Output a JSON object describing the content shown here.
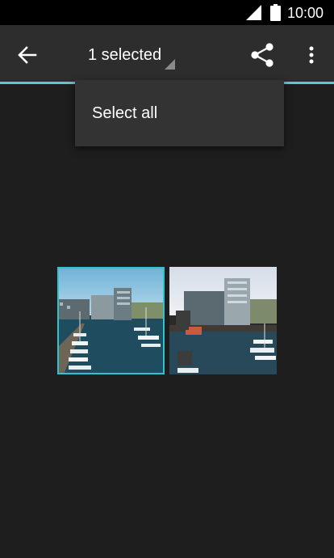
{
  "status_bar": {
    "time": "10:00",
    "signal_icon": "signal-icon",
    "battery_icon": "battery-icon"
  },
  "app_bar": {
    "back_icon": "arrow-back-icon",
    "title": "1 selected",
    "dropdown_icon": "dropdown-triangle-icon",
    "share_icon": "share-icon",
    "overflow_icon": "more-vert-icon",
    "accent_color": "#5ec8c8"
  },
  "popup_menu": {
    "items": [
      {
        "label": "Select all"
      }
    ]
  },
  "gallery": {
    "items": [
      {
        "selected": true
      },
      {
        "selected": false
      }
    ],
    "selection_color": "#2ec4cf"
  }
}
